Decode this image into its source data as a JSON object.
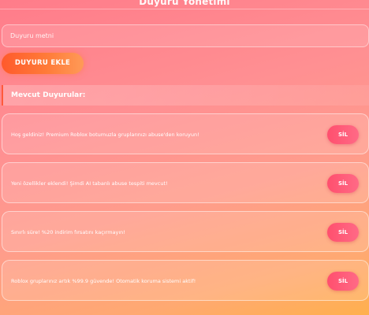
{
  "header": {
    "title": "Duyuru Yönetimi"
  },
  "form": {
    "input_placeholder": "Duyuru metni",
    "input_value": "",
    "add_button_label": "DUYURU EKLE"
  },
  "section": {
    "title": "Mevcut Duyurular:"
  },
  "announcements": [
    {
      "text": "Hoş geldiniz! Premium Roblox botumuzla gruplarınızı abuse'den koruyun!",
      "delete_label": "SİL"
    },
    {
      "text": "Yeni özellikler eklendi! Şimdi AI tabanlı abuse tespiti mevcut!",
      "delete_label": "SİL"
    },
    {
      "text": "Sınırlı süre! %20 indirim fırsatını kaçırmayın!",
      "delete_label": "SİL"
    },
    {
      "text": "Roblox gruplarınız artık %99.9 güvende! Otomatik koruma sistemi aktif!",
      "delete_label": "SİL"
    }
  ],
  "colors": {
    "background_top": "#ff7c8a",
    "background_bottom": "#ffb04e",
    "add_button": "#ff6a30",
    "delete_button": "#ff5a78",
    "section_accent": "#ff5a3c"
  }
}
